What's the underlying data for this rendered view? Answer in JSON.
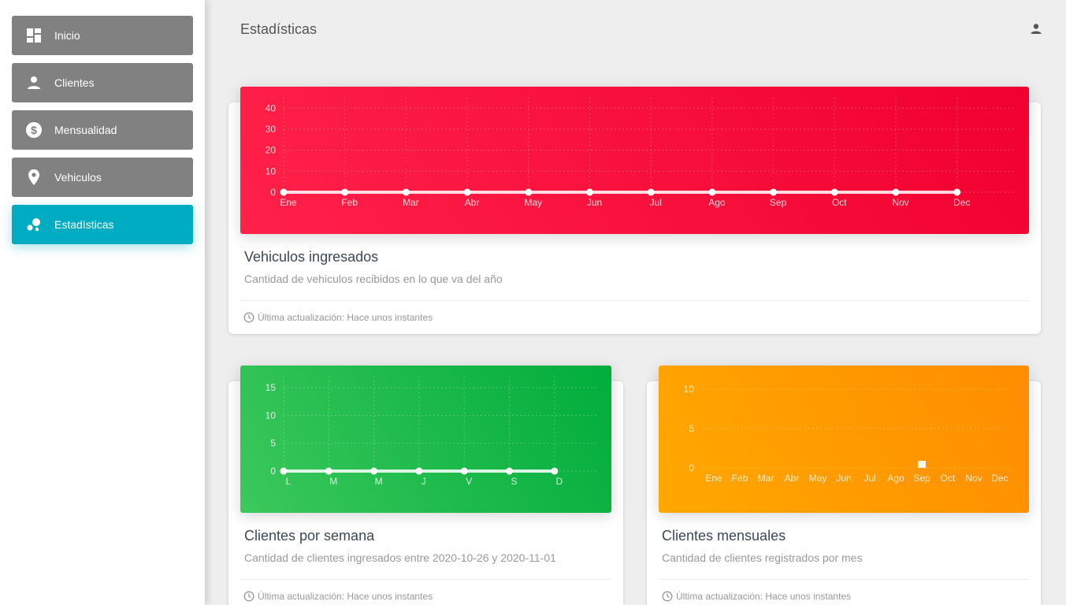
{
  "sidebar": {
    "items": [
      {
        "label": "Inicio",
        "icon": "dashboard-icon",
        "active": false
      },
      {
        "label": "Clientes",
        "icon": "person-icon",
        "active": false
      },
      {
        "label": "Mensualidad",
        "icon": "dollar-icon",
        "active": false
      },
      {
        "label": "Vehiculos",
        "icon": "location-pin-icon",
        "active": false
      },
      {
        "label": "Estadísticas",
        "icon": "bubble-chart-icon",
        "active": true
      }
    ]
  },
  "header": {
    "title": "Estadísticas",
    "user_icon": "person-icon"
  },
  "colors": {
    "sidebar_active": "#00acc1",
    "nav_item": "#818181",
    "red": "#f5133d",
    "green": "#14b045",
    "orange": "#ff9800"
  },
  "cards": [
    {
      "title": "Vehiculos ingresados",
      "category": "Cantidad de vehiculos recibidos en lo que va del año",
      "footer": "Última actualización: Hace unos instantes"
    },
    {
      "title": "Clientes por semana",
      "category": "Cantidad de clientes ingresados entre 2020-10-26 y 2020-11-01",
      "footer": "Última actualización: Hace unos instantes"
    },
    {
      "title": "Clientes mensuales",
      "category": "Cantidad de clientes registrados por mes",
      "footer": "Última actualización: Hace unos instantes"
    }
  ],
  "chart_data": [
    {
      "type": "line",
      "categories": [
        "Ene",
        "Feb",
        "Mar",
        "Abr",
        "May",
        "Jun",
        "Jul",
        "Ago",
        "Sep",
        "Oct",
        "Nov",
        "Dec"
      ],
      "values": [
        0,
        0,
        0,
        0,
        0,
        0,
        0,
        0,
        0,
        0,
        0,
        0
      ],
      "yticks": [
        0,
        10,
        20,
        30,
        40
      ],
      "ylim": [
        0,
        45
      ],
      "grid": true
    },
    {
      "type": "line",
      "categories": [
        "L",
        "M",
        "M",
        "J",
        "V",
        "S",
        "D"
      ],
      "values": [
        0,
        0,
        0,
        0,
        0,
        0,
        0
      ],
      "yticks": [
        0,
        5,
        10,
        15
      ],
      "ylim": [
        0,
        17
      ],
      "grid": true
    },
    {
      "type": "bar",
      "categories": [
        "Ene",
        "Feb",
        "Mar",
        "Abr",
        "May",
        "Jun",
        "Jul",
        "Ago",
        "Sep",
        "Oct",
        "Nov",
        "Dec"
      ],
      "values": [
        0,
        0,
        0,
        0,
        0,
        0,
        0,
        0,
        0.5,
        0,
        0,
        0
      ],
      "yticks": [
        0,
        5,
        10
      ],
      "ylim": [
        0,
        10
      ],
      "grid": true
    }
  ]
}
